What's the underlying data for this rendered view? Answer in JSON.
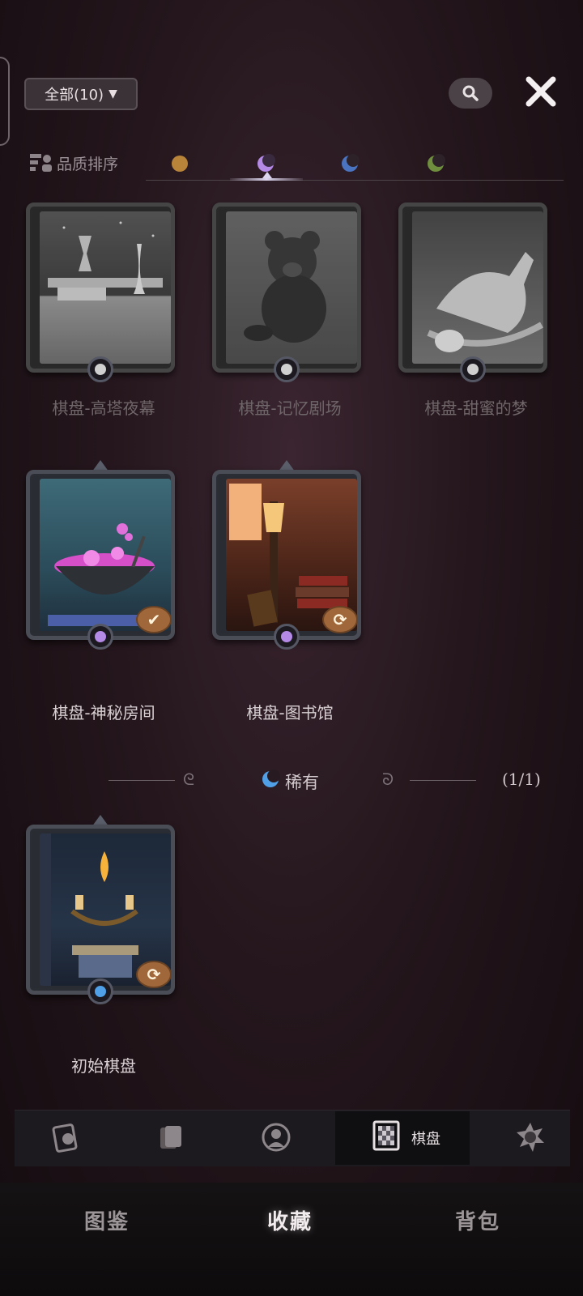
{
  "header": {
    "filter_label": "全部(10)",
    "sort_label": "品质排序",
    "quality_colors": [
      "#b8843a",
      "#b48ae6",
      "#4a74c0",
      "#6f8f3e"
    ]
  },
  "cards_top": [
    {
      "name": "棋盘-高塔夜幕"
    },
    {
      "name": "棋盘-记忆剧场"
    },
    {
      "name": "棋盘-甜蜜的梦"
    }
  ],
  "cards_owned": [
    {
      "name": "棋盘-神秘房间",
      "badge": "✔"
    },
    {
      "name": "棋盘-图书馆",
      "badge": "⟳"
    }
  ],
  "rare_section": {
    "label": "稀有",
    "count": "(1/1)",
    "cards": [
      {
        "name": "初始棋盘",
        "badge": "⟳"
      }
    ]
  },
  "tabbar": {
    "active_label": "棋盘",
    "icons": [
      "card-face-icon",
      "card-stack-icon",
      "portrait-icon",
      "board-icon",
      "sun-icon"
    ]
  },
  "bottom_nav": {
    "tabs": [
      "图鉴",
      "收藏",
      "背包"
    ],
    "active": "收藏"
  }
}
